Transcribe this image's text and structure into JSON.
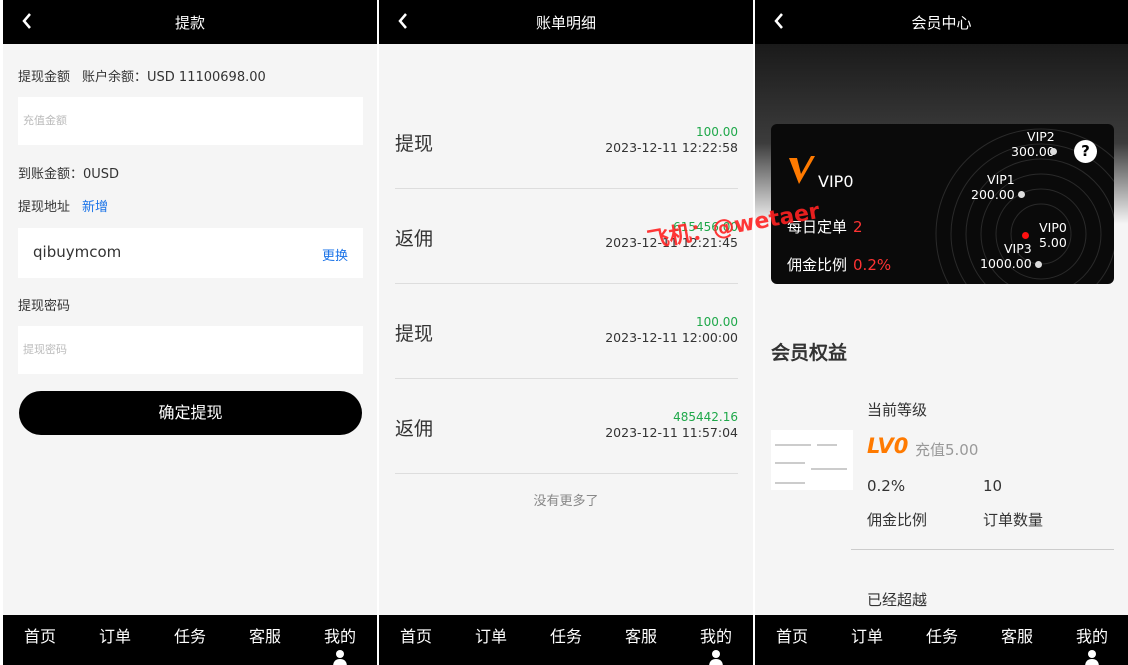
{
  "panel1": {
    "title": "提款",
    "amount_label": "提现金额",
    "balance": "账户余额：USD 11100698.00",
    "amount_placeholder": "充值金额",
    "arrival": "到账金额：0USD",
    "address_label": "提现地址",
    "address_add": "新增",
    "address_value": "qibuymcom",
    "address_change": "更换",
    "password_label": "提现密码",
    "password_placeholder": "提现密码",
    "submit": "确定提现"
  },
  "panel2": {
    "title": "账单明细",
    "records": [
      {
        "type": "提现",
        "amount": "100.00",
        "time": "2023-12-11 12:22:58"
      },
      {
        "type": "返佣",
        "amount": "615456.00",
        "time": "2023-12-11 12:21:45"
      },
      {
        "type": "提现",
        "amount": "100.00",
        "time": "2023-12-11 12:00:00"
      },
      {
        "type": "返佣",
        "amount": "485442.16",
        "time": "2023-12-11 11:57:04"
      }
    ],
    "no_more": "没有更多了",
    "watermark": "飞机：@wetaer"
  },
  "panel3": {
    "title": "会员中心",
    "card": {
      "vip_name": "VIP0",
      "daily_orders_label": "每日定单",
      "daily_orders_value": "2",
      "commission_label": "佣金比例",
      "commission_value": "0.2%",
      "help": "?",
      "levels": [
        {
          "name": "VIP2",
          "value": "300.00"
        },
        {
          "name": "VIP1",
          "value": "200.00"
        },
        {
          "name": "VIP0",
          "value": "5.00"
        },
        {
          "name": "VIP3",
          "value": "1000.00"
        }
      ]
    },
    "benefits_title": "会员权益",
    "current_level_label": "当前等级",
    "current_level": "LV0",
    "recharge": "充值5.00",
    "commission_rate": "0.2%",
    "commission_rate_label": "佣金比例",
    "order_count": "10",
    "order_count_label": "订单数量",
    "surpassed": "已经超越"
  },
  "tabs": [
    "首页",
    "订单",
    "任务",
    "客服",
    "我的"
  ]
}
